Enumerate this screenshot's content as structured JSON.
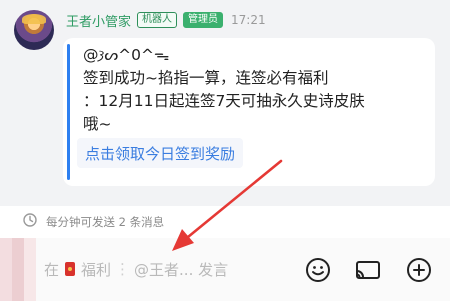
{
  "message": {
    "sender_name": "王者小管家",
    "badges": [
      "机器人",
      "管理员"
    ],
    "timestamp": "17:21",
    "lines": [
      "@𐦯ᔕ^0^ᯓ",
      "签到成功~掐指一算，连签必有福利",
      "：12月11日起连签7天可抽永久史诗皮肤",
      "哦~"
    ],
    "link_text": "点击领取今日签到奖励"
  },
  "rate_limit_text": "每分钟可发送 2 条消息",
  "input": {
    "placeholder_prefix": "在",
    "placeholder_middle": "福利",
    "placeholder_suffix": "@王者... 发言"
  },
  "icons": {
    "rate": "timer-icon",
    "emoji": "emoji-icon",
    "cast": "screen-cast-icon",
    "plus": "plus-icon"
  },
  "colors": {
    "sender": "#2e9b63",
    "link": "#3a7de0",
    "quote_bar": "#2d7ff0",
    "annotation_arrow": "#e53935"
  }
}
